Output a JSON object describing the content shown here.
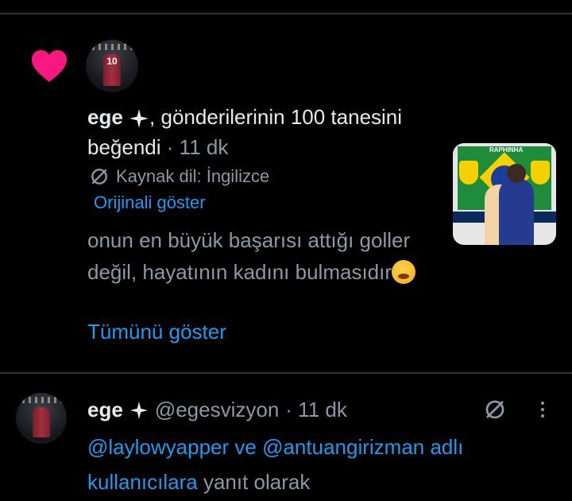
{
  "notification": {
    "user_name": "ege",
    "action_text": ", gönderilerinin 100 tanesini beğendi",
    "time": "· 11 dk",
    "translated_label": "Kaynak dil: İngilizce",
    "show_original": "Orijinali göster",
    "post_text": "onun en büyük başarısı attığı goller değil, hayatının kadını bulmasıdır",
    "show_all": "Tümünü göster",
    "thumbnail_caption": "RAPHINHA"
  },
  "tweet": {
    "user_name": "ege",
    "handle": "@egesvizyon",
    "time": "· 11 dk",
    "reply_user1": "@laylowyapper",
    "reply_and": "ve",
    "reply_user2": "@antuangirizman adlı kullanıcılara",
    "reply_suffix": "yanıt olarak"
  },
  "avatar_number": "10",
  "colors": {
    "background": "#000000",
    "text": "#e7e9ea",
    "secondary": "#8b98a5",
    "link": "#1d9bf0",
    "heart": "#f91880"
  },
  "icons": [
    "heart-icon",
    "verified-star-icon",
    "translate-icon",
    "more-icon"
  ]
}
